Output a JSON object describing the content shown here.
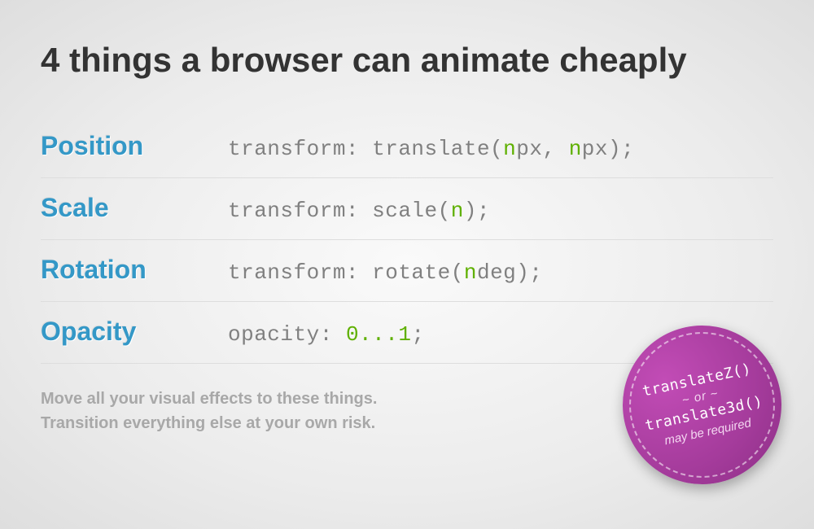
{
  "title": "4 things a browser can animate cheaply",
  "rows": [
    {
      "label": "Position",
      "code_pre": "transform: translate(",
      "hl1": "n",
      "mid1": "px, ",
      "hl2": "n",
      "mid2": "px);"
    },
    {
      "label": "Scale",
      "code_pre": "transform: scale(",
      "hl1": "n",
      "mid1": ");",
      "hl2": "",
      "mid2": ""
    },
    {
      "label": "Rotation",
      "code_pre": "transform: rotate(",
      "hl1": "n",
      "mid1": "deg);",
      "hl2": "",
      "mid2": ""
    },
    {
      "label": "Opacity",
      "code_pre": "opacity: ",
      "hl1": "0...1",
      "mid1": ";",
      "hl2": "",
      "mid2": ""
    }
  ],
  "footer_line1": "Move all your visual effects to these things.",
  "footer_line2": "Transition everything else at your own risk.",
  "badge": {
    "line1": "translateZ()",
    "line2": "or",
    "line3": "translate3d()",
    "line4": "may be required"
  }
}
